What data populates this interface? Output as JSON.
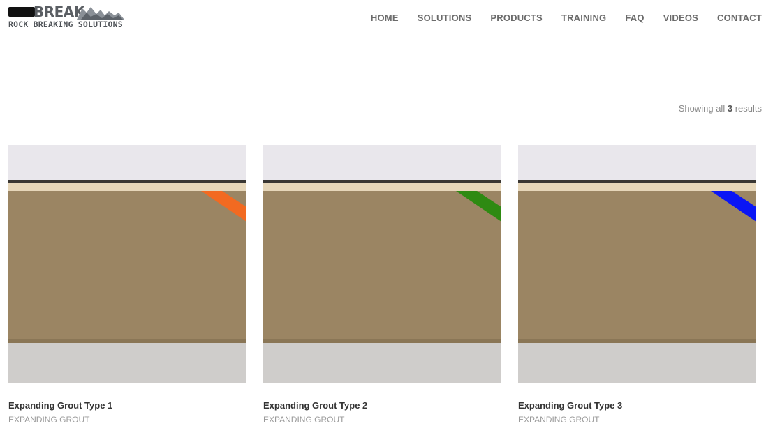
{
  "brand": {
    "wordmark": "BREAK",
    "tagline": "ROCK BREAKING SOLUTIONS"
  },
  "nav": [
    {
      "label": "HOME"
    },
    {
      "label": "SOLUTIONS"
    },
    {
      "label": "PRODUCTS"
    },
    {
      "label": "TRAINING"
    },
    {
      "label": "FAQ"
    },
    {
      "label": "VIDEOS"
    },
    {
      "label": "CONTACT"
    }
  ],
  "results": {
    "prefix": "Showing all",
    "count": "3",
    "suffix": "results"
  },
  "products": [
    {
      "title": "Expanding Grout Type 1",
      "category": "EXPANDING GROUT",
      "stripe_color": "#f26a21"
    },
    {
      "title": "Expanding Grout Type 2",
      "category": "EXPANDING GROUT",
      "stripe_color": "#2e8a12"
    },
    {
      "title": "Expanding Grout Type 3",
      "category": "EXPANDING GROUT",
      "stripe_color": "#0a16f5"
    }
  ],
  "colors": {
    "box": "#9b8563",
    "box_top": "#e6d6b9",
    "wall": "#e9e7ec",
    "carpet": "#cfcdcb"
  }
}
